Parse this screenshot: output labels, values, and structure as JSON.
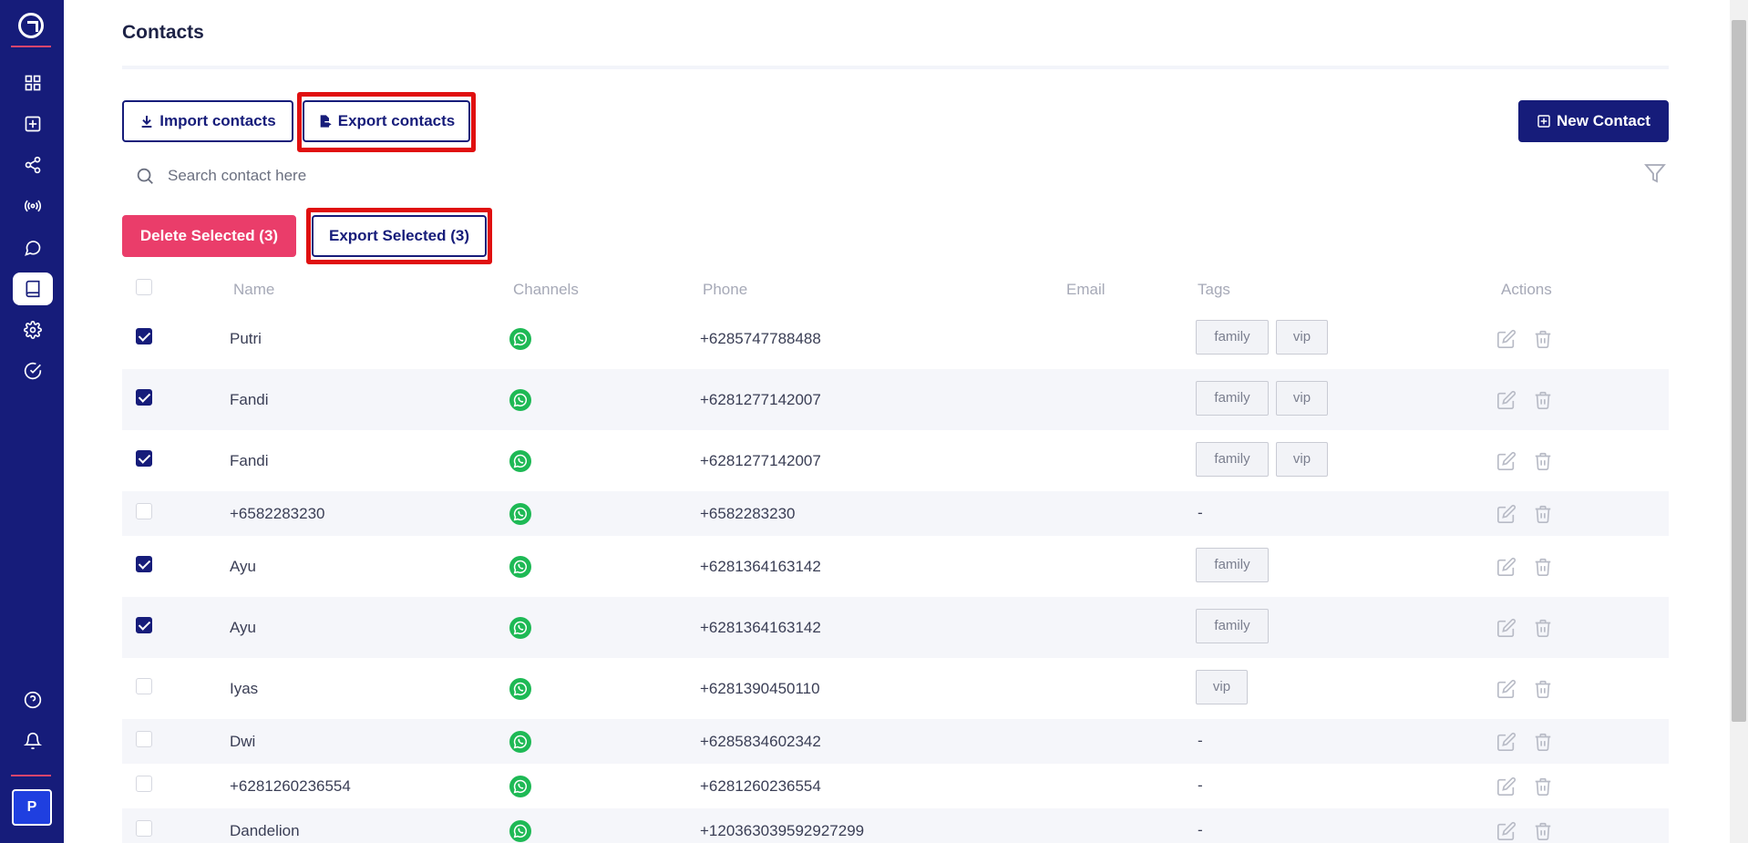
{
  "sidebar": {
    "items": [
      {
        "icon": "dashboard-icon",
        "active": false
      },
      {
        "icon": "add-square-icon",
        "active": false
      },
      {
        "icon": "share-icon",
        "active": false
      },
      {
        "icon": "broadcast-icon",
        "active": false
      },
      {
        "icon": "chat-icon",
        "active": false
      },
      {
        "icon": "contacts-book-icon",
        "active": true
      },
      {
        "icon": "settings-icon",
        "active": false
      },
      {
        "icon": "check-circle-icon",
        "active": false
      }
    ],
    "bottom": [
      {
        "icon": "help-icon"
      },
      {
        "icon": "bell-icon"
      }
    ],
    "avatar_initial": "P"
  },
  "page": {
    "title": "Contacts"
  },
  "toolbar": {
    "import_label": "Import contacts",
    "export_label": "Export contacts",
    "new_label": "New Contact"
  },
  "search": {
    "placeholder": "Search contact here",
    "value": ""
  },
  "bulk": {
    "delete_label": "Delete Selected (3)",
    "export_label": "Export Selected (3)"
  },
  "table": {
    "headers": {
      "name": "Name",
      "channels": "Channels",
      "phone": "Phone",
      "email": "Email",
      "tags": "Tags",
      "actions": "Actions"
    },
    "rows": [
      {
        "checked": true,
        "name": "Putri",
        "phone": "+6285747788488",
        "email": "",
        "tags": [
          "family",
          "vip"
        ]
      },
      {
        "checked": true,
        "name": "Fandi",
        "phone": "+6281277142007",
        "email": "",
        "tags": [
          "family",
          "vip"
        ]
      },
      {
        "checked": true,
        "name": "Fandi",
        "phone": "+6281277142007",
        "email": "",
        "tags": [
          "family",
          "vip"
        ]
      },
      {
        "checked": false,
        "name": "+6582283230",
        "phone": "+6582283230",
        "email": "",
        "tags": [],
        "empty_tag": "-"
      },
      {
        "checked": true,
        "name": "Ayu",
        "phone": "+6281364163142",
        "email": "",
        "tags": [
          "family"
        ]
      },
      {
        "checked": true,
        "name": "Ayu",
        "phone": "+6281364163142",
        "email": "",
        "tags": [
          "family"
        ]
      },
      {
        "checked": false,
        "name": "Iyas",
        "phone": "+6281390450110",
        "email": "",
        "tags": [
          "vip"
        ]
      },
      {
        "checked": false,
        "name": "Dwi",
        "phone": "+6285834602342",
        "email": "",
        "tags": [],
        "empty_tag": "-"
      },
      {
        "checked": false,
        "name": "+6281260236554",
        "phone": "+6281260236554",
        "email": "",
        "tags": [],
        "empty_tag": "-"
      },
      {
        "checked": false,
        "name": "Dandelion",
        "phone": "+120363039592927299",
        "email": "",
        "tags": [],
        "empty_tag": "-"
      }
    ]
  },
  "colors": {
    "primary": "#161c7a",
    "danger": "#ea3d6a",
    "whatsapp": "#1eb955",
    "highlight": "#e01010"
  }
}
